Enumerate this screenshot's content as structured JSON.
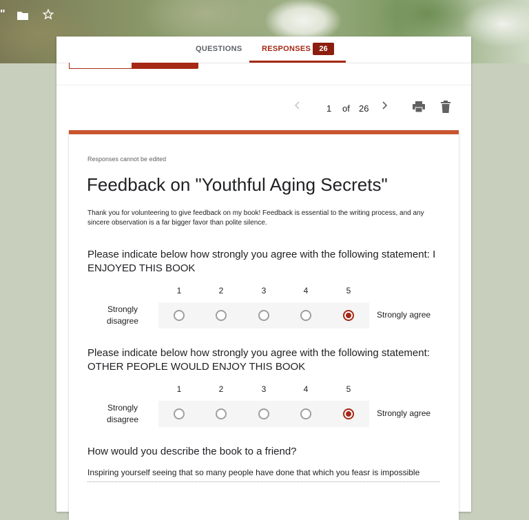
{
  "toolbar": {
    "quote_glyph": "\"",
    "icons": [
      "folder-icon",
      "star-icon"
    ]
  },
  "tabs": {
    "questions_label": "QUESTIONS",
    "responses_label": "RESPONSES",
    "responses_count": "26"
  },
  "pager": {
    "current": "1",
    "of_label": "of",
    "total": "26",
    "prev_icon": "chevron-left-icon",
    "next_icon": "chevron-right-icon",
    "actions": [
      "print-icon",
      "trash-icon"
    ]
  },
  "response": {
    "note": "Responses cannot be edited",
    "title": "Feedback on \"Youthful Aging Secrets\"",
    "description": "Thank you for volunteering to give feedback on my book! Feedback is essential to the writing process, and any sincere observation is a far bigger favor than polite silence.",
    "questions": [
      {
        "title": "Please indicate below how strongly you agree with the following statement: I ENJOYED THIS BOOK",
        "scale": [
          "1",
          "2",
          "3",
          "4",
          "5"
        ],
        "low_label": "Strongly disagree",
        "high_label": "Strongly agree",
        "selected": "5"
      },
      {
        "title": "Please indicate below how strongly you agree with the following statement: OTHER PEOPLE WOULD ENJOY THIS BOOK",
        "scale": [
          "1",
          "2",
          "3",
          "4",
          "5"
        ],
        "low_label": "Strongly disagree",
        "high_label": "Strongly agree",
        "selected": "5"
      },
      {
        "title": "How would you describe the book to a friend?",
        "answer": "Inspiring yourself seeing that so many people have done that which you feasr is impossible"
      }
    ]
  },
  "colors": {
    "accent": "#a52714",
    "card_border": "#c8552e",
    "badge_bg": "#8b1e0f"
  }
}
